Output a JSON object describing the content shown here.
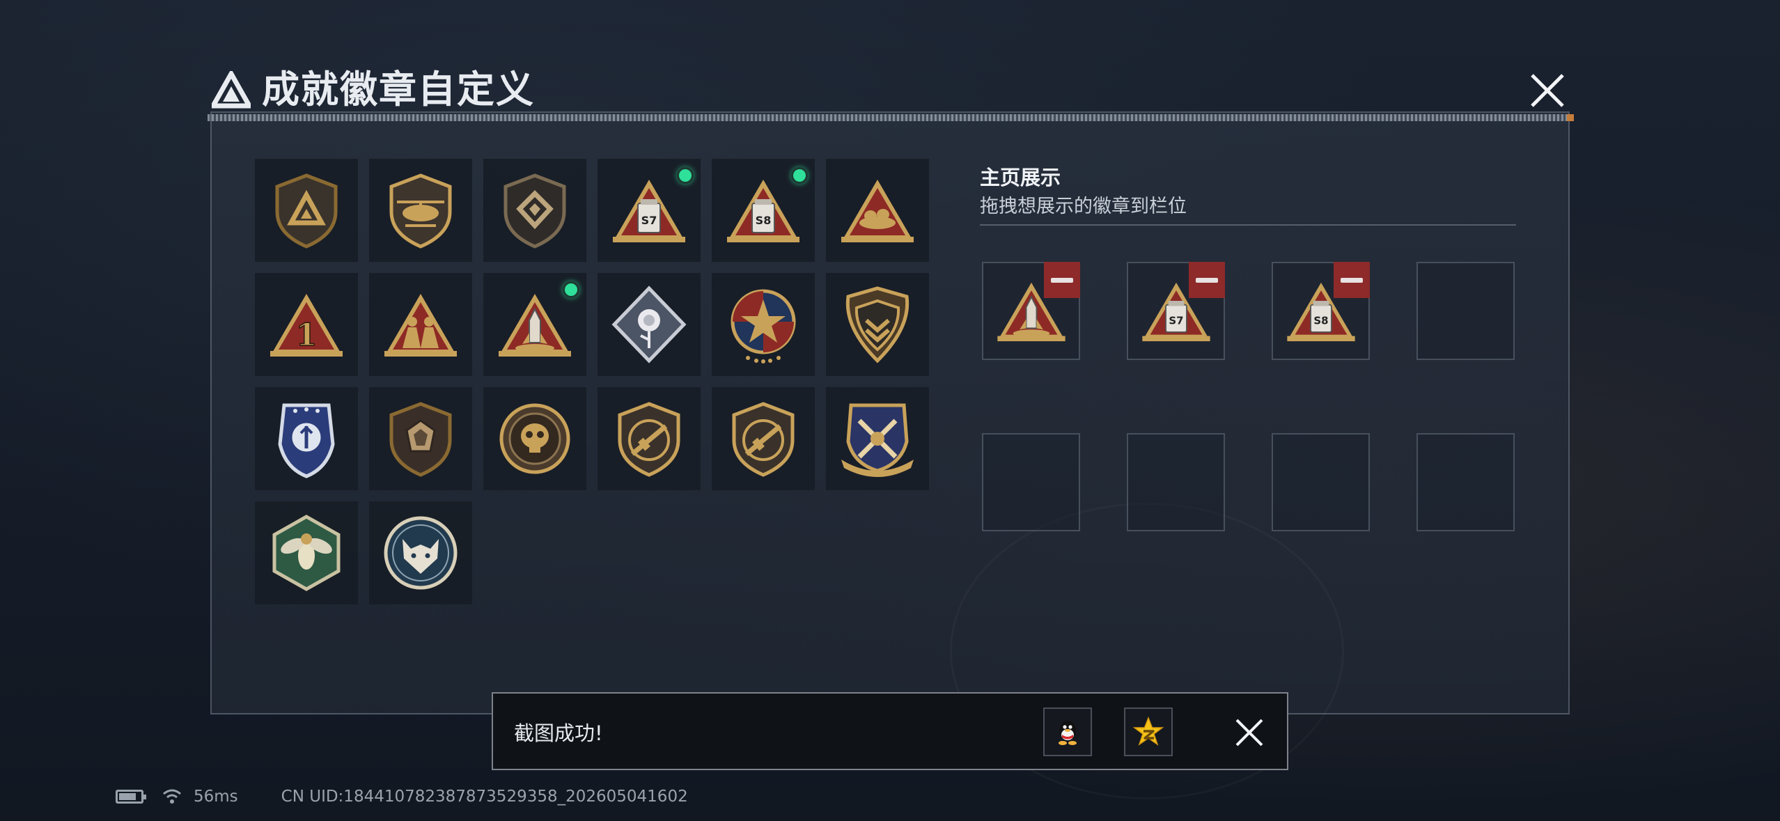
{
  "header": {
    "title": "成就徽章自定义"
  },
  "badges": [
    {
      "name": "delta-shield-badge",
      "new": false
    },
    {
      "name": "helicopter-shield-badge",
      "new": false
    },
    {
      "name": "emblem-shield-badge",
      "new": false
    },
    {
      "name": "s7-triangle-badge",
      "new": true,
      "label": "S7"
    },
    {
      "name": "s8-triangle-badge",
      "new": true,
      "label": "S8"
    },
    {
      "name": "nest-triangle-badge",
      "new": false
    },
    {
      "name": "number-one-triangle-badge",
      "new": false,
      "label": "1"
    },
    {
      "name": "soldiers-triangle-badge",
      "new": false
    },
    {
      "name": "rocket-triangle-badge",
      "new": true
    },
    {
      "name": "rose-diamond-badge",
      "new": false
    },
    {
      "name": "star-medal-badge",
      "new": false
    },
    {
      "name": "chevron-shield-badge",
      "new": false
    },
    {
      "name": "blue-wing-shield-badge",
      "new": false
    },
    {
      "name": "crystal-shield-badge",
      "new": false
    },
    {
      "name": "skull-round-badge",
      "new": false
    },
    {
      "name": "rifle-shield-badge",
      "new": false
    },
    {
      "name": "rifle-shield-badge-2",
      "new": false
    },
    {
      "name": "crossed-swords-crest-badge",
      "new": false
    },
    {
      "name": "hornet-hexagon-badge",
      "new": false
    },
    {
      "name": "wolf-round-badge",
      "new": false
    }
  ],
  "showcase": {
    "title": "主页展示",
    "subtitle": "拖拽想展示的徽章到栏位",
    "slots": [
      {
        "badge": "rocket-triangle-badge"
      },
      {
        "badge": "s7-triangle-badge",
        "label": "S7"
      },
      {
        "badge": "s8-triangle-badge",
        "label": "S8"
      },
      {
        "badge": null
      },
      {
        "badge": null
      },
      {
        "badge": null
      },
      {
        "badge": null
      },
      {
        "badge": null
      }
    ]
  },
  "toast": {
    "message": "截图成功!",
    "icons": [
      "qq-icon",
      "qzone-star-icon"
    ]
  },
  "status": {
    "ping": "56ms",
    "uid": "CN UID:1844107823878735​29358_202605041602"
  },
  "colors": {
    "gold": "#c9a25a",
    "red_triangle": "#8e2a25",
    "new_dot": "#2fe09a",
    "remove_red": "#8e2a2a"
  }
}
